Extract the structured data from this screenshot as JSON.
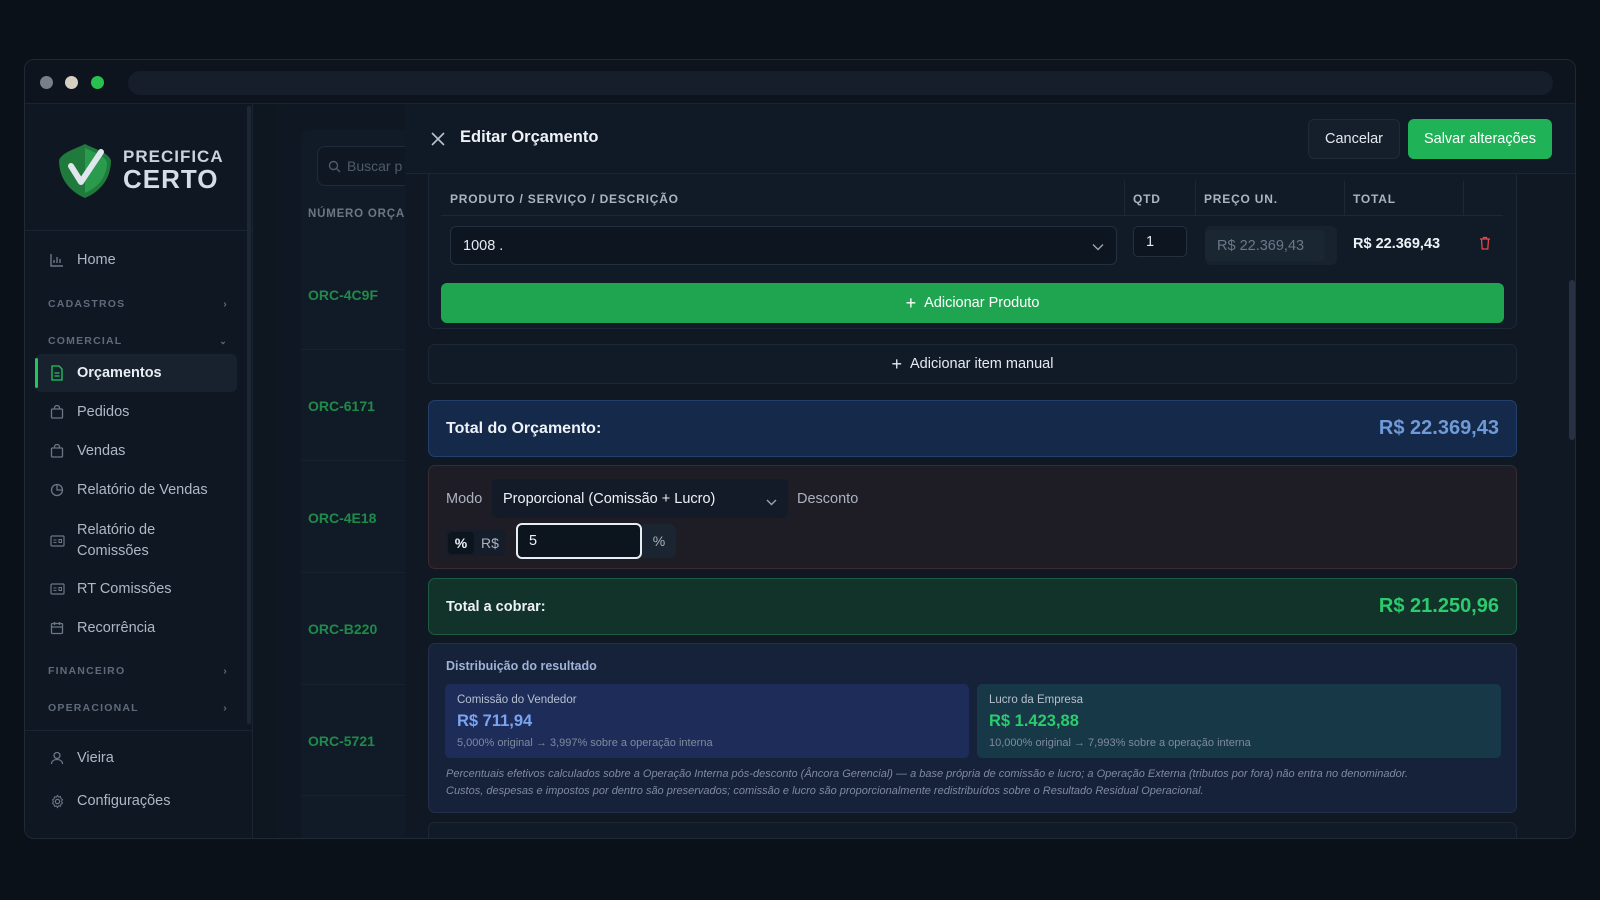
{
  "brand": {
    "line1": "PRECIFICA",
    "line2": "CERTO",
    "accent": "#22c55e"
  },
  "sidebar": {
    "home": "Home",
    "sections": {
      "cadastros": "CADASTROS",
      "comercial": "COMERCIAL",
      "financeiro": "FINANCEIRO",
      "operacional": "OPERACIONAL"
    },
    "items": {
      "orcamentos": "Orçamentos",
      "pedidos": "Pedidos",
      "vendas": "Vendas",
      "relatorio_vendas": "Relatório de Vendas",
      "relatorio_comissoes_1": "Relatório de",
      "relatorio_comissoes_2": "Comissões",
      "rt_comissoes": "RT Comissões",
      "recorrencia": "Recorrência"
    },
    "user": "Vieira",
    "settings": "Configurações"
  },
  "background_list": {
    "search_placeholder": "Buscar p",
    "column_header": "NÚMERO ORÇA",
    "rows": [
      "ORC-4C9F",
      "ORC-6171",
      "ORC-4E18",
      "ORC-B220",
      "ORC-5721"
    ]
  },
  "modal": {
    "title": "Editar Orçamento",
    "cancel": "Cancelar",
    "save": "Salvar alterações",
    "table": {
      "headers": [
        "PRODUTO / SERVIÇO / DESCRIÇÃO",
        "QTD",
        "PREÇO UN.",
        "TOTAL"
      ],
      "row": {
        "product": "1008 .",
        "qty": "1",
        "unit_price": "R$ 22.369,43",
        "total": "R$ 22.369,43"
      }
    },
    "add_product": "Adicionar Produto",
    "add_manual": "Adicionar item manual",
    "total_orcamento": {
      "label": "Total do Orçamento:",
      "value": "R$ 22.369,43"
    },
    "discount": {
      "mode_label": "Modo",
      "mode_value": "Proporcional (Comissão + Lucro)",
      "discount_label": "Desconto",
      "toggle_pct": "%",
      "toggle_rs": "R$",
      "value": "5",
      "unit": "%"
    },
    "total_cobrar": {
      "label": "Total a cobrar:",
      "value": "R$ 21.250,96"
    },
    "distribution": {
      "title": "Distribuição do resultado",
      "commission": {
        "caption": "Comissão do Vendedor",
        "amount": "R$ 711,94",
        "note": "5,000% original → 3,997% sobre a operação interna"
      },
      "profit": {
        "caption": "Lucro da Empresa",
        "amount": "R$ 1.423,88",
        "note": "10,000% original → 7,993% sobre a operação interna"
      },
      "footnote_1": "Percentuais efetivos calculados sobre a Operação Interna pós-desconto (Âncora Gerencial) — a base própria de comissão e lucro; a Operação Externa (tributos por fora) não entra no denominador.",
      "footnote_2": "Custos, despesas e impostos por dentro são preservados; comissão e lucro são proporcionalmente redistribuídos sobre o Resultado Residual Operacional."
    }
  }
}
